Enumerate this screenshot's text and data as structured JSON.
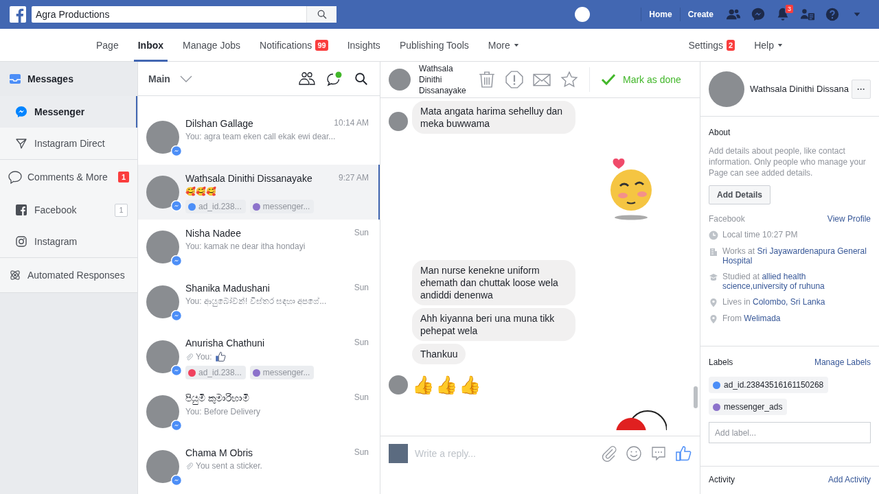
{
  "topbar": {
    "search": {
      "value": "Agra Productions"
    },
    "links": [
      "Home",
      "Create"
    ],
    "notification_count": "3"
  },
  "nav": {
    "tabs": [
      {
        "label": "Page",
        "selected": false
      },
      {
        "label": "Inbox",
        "selected": true
      },
      {
        "label": "Manage Jobs",
        "selected": false
      },
      {
        "label": "Notifications",
        "selected": false,
        "badge": "99"
      },
      {
        "label": "Insights",
        "selected": false
      },
      {
        "label": "Publishing Tools",
        "selected": false
      },
      {
        "label": "More",
        "selected": false,
        "has_menu": true
      }
    ],
    "right_tabs": [
      {
        "label": "Settings",
        "selected": false,
        "badge": "2"
      },
      {
        "label": "Help",
        "selected": false,
        "has_menu": true
      }
    ]
  },
  "sidebar": {
    "sections": [
      {
        "title": "Messages",
        "active": true,
        "items": [
          {
            "label": "Messenger",
            "selected": true
          },
          {
            "label": "Instagram Direct",
            "selected": false
          }
        ]
      },
      {
        "title": "Comments & More",
        "active": false,
        "badge": "1",
        "items": [
          {
            "label": "Facebook",
            "selected": false,
            "count": "1"
          },
          {
            "label": "Instagram",
            "selected": false
          }
        ]
      },
      {
        "title": "Automated Responses",
        "active": false
      }
    ]
  },
  "inbox": {
    "filter": "Main",
    "conversations": [
      {
        "name": "Dilshan Gallage",
        "time": "10:14 AM",
        "preview": "You: agra team eken call ekak ewi dear...",
        "selected": false,
        "attachment": false,
        "like": false
      },
      {
        "name": "Wathsala Dinithi Dissanayake",
        "time": "9:27 AM",
        "preview": "🥰🥰🥰",
        "selected": true,
        "attachment": false,
        "like": false,
        "labels": [
          {
            "text": "ad_id.238...",
            "color": "#4c8ef7"
          },
          {
            "text": "messenger...",
            "color": "#8c72cb"
          }
        ]
      },
      {
        "name": "Nisha Nadee",
        "time": "Sun",
        "preview": "You: kamak ne dear itha hondayi",
        "selected": false,
        "attachment": false,
        "like": false
      },
      {
        "name": "Shanika Madushani",
        "time": "Sun",
        "preview": "You: ආයුබෝවන්! විස්තර සඳහා අපගේ...",
        "selected": false,
        "attachment": false,
        "like": false
      },
      {
        "name": "Anurisha Chathuni",
        "time": "Sun",
        "preview": "You:",
        "selected": false,
        "attachment": true,
        "like": true,
        "labels": [
          {
            "text": "ad_id.238...",
            "color": "#f0425f"
          },
          {
            "text": "messenger...",
            "color": "#8c72cb"
          }
        ]
      },
      {
        "name": "පියුමි කුමාරිහාමි",
        "time": "Sun",
        "preview": "You: Before Delivery",
        "selected": false,
        "attachment": false,
        "like": false
      },
      {
        "name": "Chama M Obris",
        "time": "Sun",
        "preview": "You sent a sticker.",
        "selected": false,
        "attachment": true,
        "like": false
      }
    ]
  },
  "chat": {
    "contact": "Wathsala Dinithi Dissanayake",
    "done_label": "Mark as done",
    "messages": [
      {
        "kind": "text",
        "text": "Mata angata harima sehelluy dan meka buwwama",
        "avatar": true
      },
      {
        "kind": "sticker",
        "avatar": false
      },
      {
        "kind": "text",
        "text": "Man nurse kenekne uniform ehemath dan chuttak loose wela andiddi denenwa",
        "avatar": false
      },
      {
        "kind": "text",
        "text": "Ahh kiyanna beri una muna tikk pehepat wela",
        "avatar": false
      },
      {
        "kind": "text",
        "text": "Thankuu",
        "avatar": false
      },
      {
        "kind": "emoji",
        "text": "👍👍👍",
        "avatar": true
      },
      {
        "kind": "sticker_partial",
        "avatar": false
      }
    ],
    "composer": {
      "placeholder": "Write a reply..."
    }
  },
  "profile": {
    "name": "Wathsala Dinithi Dissana",
    "more": "···",
    "about": {
      "title": "About",
      "text": "Add details about people, like contact information. Only people who manage your Page can see added details.",
      "button": "Add Details",
      "source": "Facebook",
      "source_link": "View Profile",
      "details": [
        {
          "kind": "clock",
          "text": "Local time 10:27 PM"
        },
        {
          "kind": "work",
          "text": "Works at",
          "link": "Sri Jayawardenapura General Hospital"
        },
        {
          "kind": "school",
          "text": "Studied at",
          "link": "allied health science,university of ruhuna"
        },
        {
          "kind": "place",
          "text": "Lives in",
          "link": "Colombo, Sri Lanka"
        },
        {
          "kind": "place",
          "text": "From",
          "link": "Welimada"
        }
      ]
    },
    "labels": {
      "title": "Labels",
      "action": "Manage Labels",
      "items": [
        {
          "text": "ad_id.23843516161150268",
          "color": "#4c8ef7"
        },
        {
          "text": "messenger_ads",
          "color": "#8c72cb"
        }
      ],
      "placeholder": "Add label..."
    },
    "activity": {
      "title": "Activity",
      "action": "Add Activity"
    }
  }
}
